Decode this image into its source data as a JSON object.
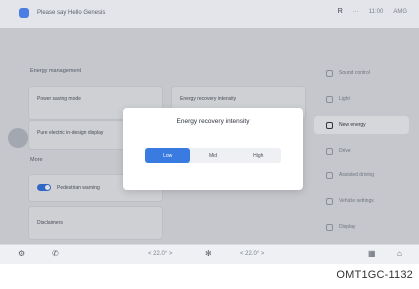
{
  "header": {
    "profile_name": "Please say Hello Genesis",
    "status_items": [
      "R",
      "···",
      "11:00",
      "AMG"
    ]
  },
  "main": {
    "energy_section_title": "Energy management",
    "card_power_saving": "Power saving mode",
    "card_energy_recovery": "Energy recovery intensity",
    "card_pure_electric": "Pure electric in-design display",
    "more_section_title": "More",
    "card_pedestrian": "Pedestrian warning",
    "card_disclaimers": "Disclaimers"
  },
  "sidebar": {
    "items": [
      {
        "label": "Sound control",
        "icon": "speaker-icon",
        "active": false
      },
      {
        "label": "Light",
        "icon": "light-icon",
        "active": false
      },
      {
        "label": "New energy",
        "icon": "leaf-icon",
        "active": true
      },
      {
        "label": "Drive",
        "icon": "car-icon",
        "active": false
      },
      {
        "label": "Assisted driving",
        "icon": "steering-icon",
        "active": false
      },
      {
        "label": "Vehicle settings",
        "icon": "settings-icon",
        "active": false
      },
      {
        "label": "Display",
        "icon": "display-icon",
        "active": false
      }
    ]
  },
  "dialog": {
    "title": "Energy recovery intensity",
    "options": [
      "Low",
      "Mid",
      "High"
    ],
    "selected": "Low"
  },
  "bottombar": {
    "left_temp": "< 22.0° >",
    "right_temp": "< 22.0° >"
  },
  "caption": "OMT1GC-1132"
}
